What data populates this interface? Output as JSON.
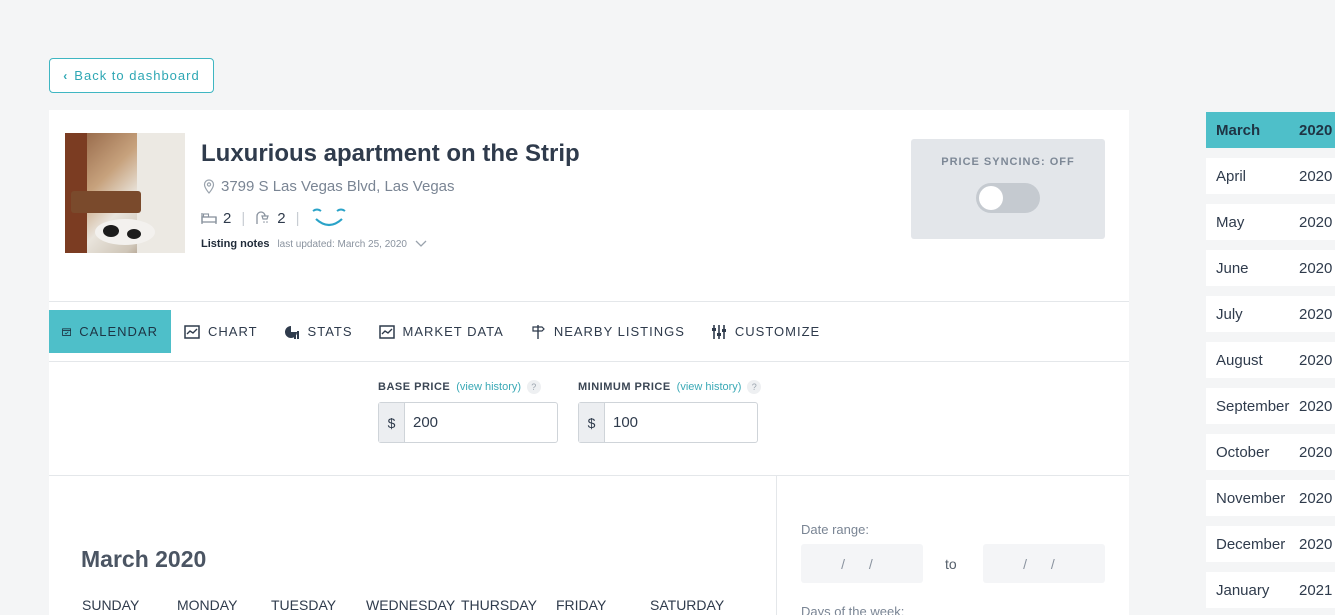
{
  "back_label": "Back to dashboard",
  "listing": {
    "title": "Luxurious apartment on the Strip",
    "address": "3799 S Las Vegas Blvd, Las Vegas",
    "bedrooms": "2",
    "bathrooms": "2",
    "notes_label": "Listing notes",
    "notes_updated": "last updated: March 25, 2020"
  },
  "price_sync": {
    "label": "PRICE SYNCING: OFF",
    "enabled": false
  },
  "tabs": [
    {
      "label": "CALENDAR",
      "icon": "calendar-icon"
    },
    {
      "label": "CHART",
      "icon": "chart-icon"
    },
    {
      "label": "STATS",
      "icon": "stats-icon"
    },
    {
      "label": "MARKET DATA",
      "icon": "market-data-icon"
    },
    {
      "label": "NEARBY LISTINGS",
      "icon": "signpost-icon"
    },
    {
      "label": "CUSTOMIZE",
      "icon": "sliders-icon"
    }
  ],
  "base_price": {
    "label": "BASE PRICE",
    "link": "(view history)",
    "currency": "$",
    "value": "200"
  },
  "minimum_price": {
    "label": "MINIMUM PRICE",
    "link": "(view history)",
    "currency": "$",
    "value": "100"
  },
  "calendar": {
    "month_title": "March 2020",
    "weekdays": [
      "SUNDAY",
      "MONDAY",
      "TUESDAY",
      "WEDNESDAY",
      "THURSDAY",
      "FRIDAY",
      "SATURDAY"
    ]
  },
  "filters": {
    "date_range_label": "Date range:",
    "date_placeholder": "/  /",
    "to_label": "to",
    "days_of_week_label": "Days of the week:"
  },
  "months": [
    {
      "name": "March",
      "year": "2020",
      "active": true
    },
    {
      "name": "April",
      "year": "2020"
    },
    {
      "name": "May",
      "year": "2020"
    },
    {
      "name": "June",
      "year": "2020"
    },
    {
      "name": "July",
      "year": "2020"
    },
    {
      "name": "August",
      "year": "2020"
    },
    {
      "name": "September",
      "year": "2020"
    },
    {
      "name": "October",
      "year": "2020"
    },
    {
      "name": "November",
      "year": "2020"
    },
    {
      "name": "December",
      "year": "2020"
    },
    {
      "name": "January",
      "year": "2021"
    }
  ],
  "colors": {
    "accent": "#4ebfc9",
    "link": "#3aa9b6",
    "text": "#2f3b4c"
  }
}
